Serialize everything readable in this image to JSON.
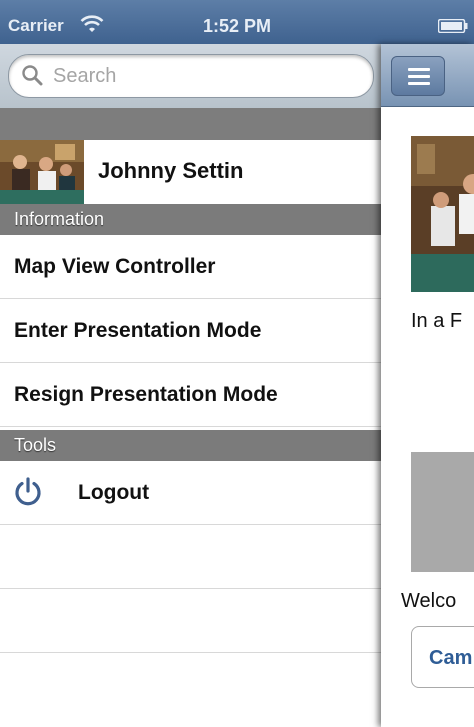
{
  "status_bar": {
    "carrier": "Carrier",
    "time": "1:52 PM",
    "wifi_icon": "wifi-icon",
    "battery_icon": "battery-icon"
  },
  "search": {
    "placeholder": "Search",
    "value": "",
    "icon": "search-icon"
  },
  "profile": {
    "name": "Johnny Settin",
    "avatar_icon": "avatar-photo"
  },
  "sections": [
    {
      "header": "Information",
      "items": [
        "Map View Controller",
        "Enter Presentation Mode",
        "Resign Presentation Mode"
      ]
    },
    {
      "header": "Tools",
      "items": [
        "Logout"
      ]
    }
  ],
  "logout_icon": "power-icon",
  "content": {
    "menu_icon": "hamburger-icon",
    "text1": "In a F",
    "text2": "Welco",
    "button_label": "Cam"
  },
  "colors": {
    "status_bar": "#4a6b95",
    "section_header": "#7b7b7b",
    "button_text": "#2f5d96",
    "power_icon": "#3f5f8e"
  }
}
